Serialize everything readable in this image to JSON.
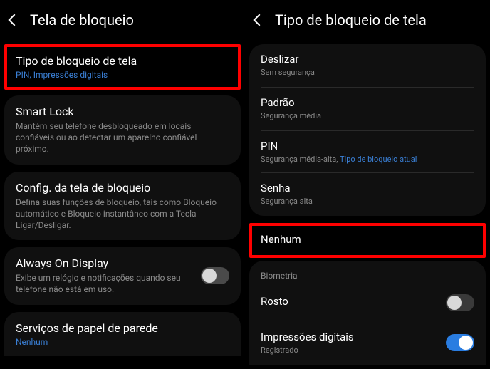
{
  "left": {
    "header_title": "Tela de bloqueio",
    "panel1": {
      "type_title": "Tipo de bloqueio de tela",
      "type_sub": "PIN, Impressões digitais",
      "smartlock_title": "Smart Lock",
      "smartlock_sub": "Mantém seu telefone desbloqueado em locais confiáveis ou ao detectar um aparelho confiável próximo."
    },
    "panel2": {
      "config_title": "Config. da tela de bloqueio",
      "config_sub": "Defina suas funções de bloqueio, tais como Bloqueio automático e Bloqueio instantâneo com a Tecla Ligar/Desligar."
    },
    "panel3": {
      "aod_title": "Always On Display",
      "aod_sub": "Exibe um relógio e notificações quando seu telefone não está em uso."
    },
    "panel4": {
      "wallpaper_title": "Serviços de papel de parede",
      "wallpaper_sub": "Nenhum"
    }
  },
  "right": {
    "header_title": "Tipo de bloqueio de tela",
    "items": {
      "swipe_title": "Deslizar",
      "swipe_sub": "Sem segurança",
      "pattern_title": "Padrão",
      "pattern_sub": "Segurança média",
      "pin_title": "PIN",
      "pin_sub_prefix": "Segurança média-alta, ",
      "pin_sub_current": "Tipo de bloqueio atual",
      "password_title": "Senha",
      "password_sub": "Segurança alta",
      "none_title": "Nenhum"
    },
    "biometrics_header": "Biometria",
    "face_title": "Rosto",
    "fingerprint_title": "Impressões digitais",
    "fingerprint_sub": "Registrado"
  }
}
